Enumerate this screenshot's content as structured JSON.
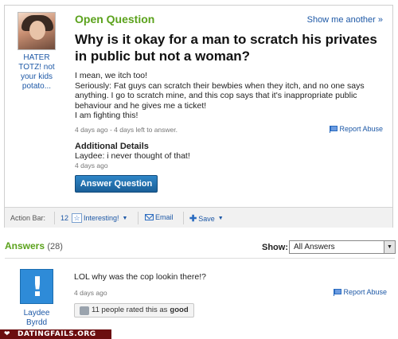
{
  "question": {
    "label": "Open Question",
    "show_another": "Show me another »",
    "title": "Why is it okay for a man to scratch his privates in public but not a woman?",
    "body": [
      "I mean, we itch too!",
      "Seriously: Fat guys can scratch their bewbies when they itch, and no one says anything. I go to scratch mine, and this cop says that it's inappropriate public behaviour and he gives me a ticket!",
      "I am fighting this!"
    ],
    "meta": "4 days ago - 4 days left to answer.",
    "report": "Report Abuse",
    "additional_heading": "Additional Details",
    "additional_text": "Laydee: i never thought of that!",
    "additional_meta": "4 days ago",
    "answer_button": "Answer Question",
    "asker_name": "HATER TOTZ! not your kids potato..."
  },
  "action_bar": {
    "label": "Action Bar:",
    "interesting_count": "12",
    "interesting_label": "Interesting!",
    "email_label": "Email",
    "save_label": "Save"
  },
  "answers": {
    "heading": "Answers",
    "count": "(28)",
    "show_label": "Show:",
    "show_value": "All Answers",
    "items": [
      {
        "user": "Laydee Byrdd",
        "text": "LOL why was the cop lookin there!?",
        "meta": "4 days ago",
        "report": "Report Abuse",
        "rating_prefix": "11 people rated this as",
        "rating_word": "good"
      }
    ]
  },
  "footer": {
    "text": "DATINGFAILS.ORG"
  },
  "colors": {
    "accent_green": "#5ba21c",
    "link_blue": "#1d58a6",
    "button_blue": "#1a5f98",
    "footer": "#6c0e10"
  }
}
